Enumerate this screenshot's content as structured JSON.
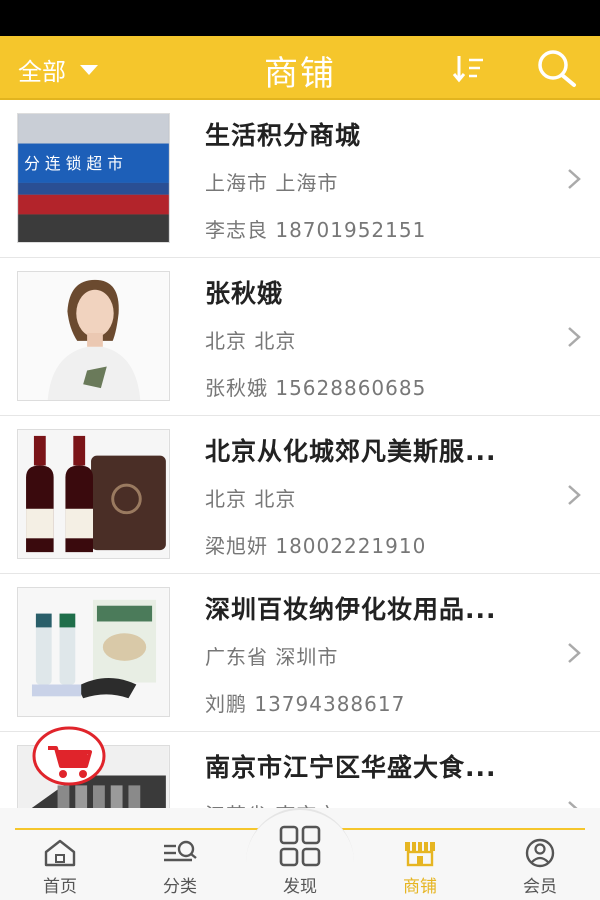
{
  "header": {
    "filter_label": "全部",
    "title": "商铺"
  },
  "shops": [
    {
      "name": "生活积分商城",
      "location": "上海市 上海市",
      "contact": "李志良 18701952151",
      "thumb": "supermarket-storefront"
    },
    {
      "name": "张秋娥",
      "location": "北京 北京",
      "contact": "张秋娥 15628860685",
      "thumb": "woman-portrait"
    },
    {
      "name": "北京从化城郊凡美斯服...",
      "location": "北京 北京",
      "contact": "梁旭妍 18002221910",
      "thumb": "wine-bottles"
    },
    {
      "name": "深圳百妆纳伊化妆用品...",
      "location": "广东省 深圳市",
      "contact": "刘鹏   13794388617",
      "thumb": "cosmetics-products"
    },
    {
      "name": "南京市江宁区华盛大食...",
      "location": "江苏省 南京市",
      "contact": "",
      "thumb": "food-box"
    }
  ],
  "storefront_sign": "分 连 锁 超 市",
  "tabs": [
    {
      "label": "首页",
      "icon": "home-icon"
    },
    {
      "label": "分类",
      "icon": "category-icon"
    },
    {
      "label": "发现",
      "icon": "grid-icon"
    },
    {
      "label": "商铺",
      "icon": "shop-icon"
    },
    {
      "label": "会员",
      "icon": "user-icon"
    }
  ],
  "colors": {
    "accent": "#f5c62c",
    "active_tab": "#e6b522",
    "cart": "#e0242b"
  }
}
